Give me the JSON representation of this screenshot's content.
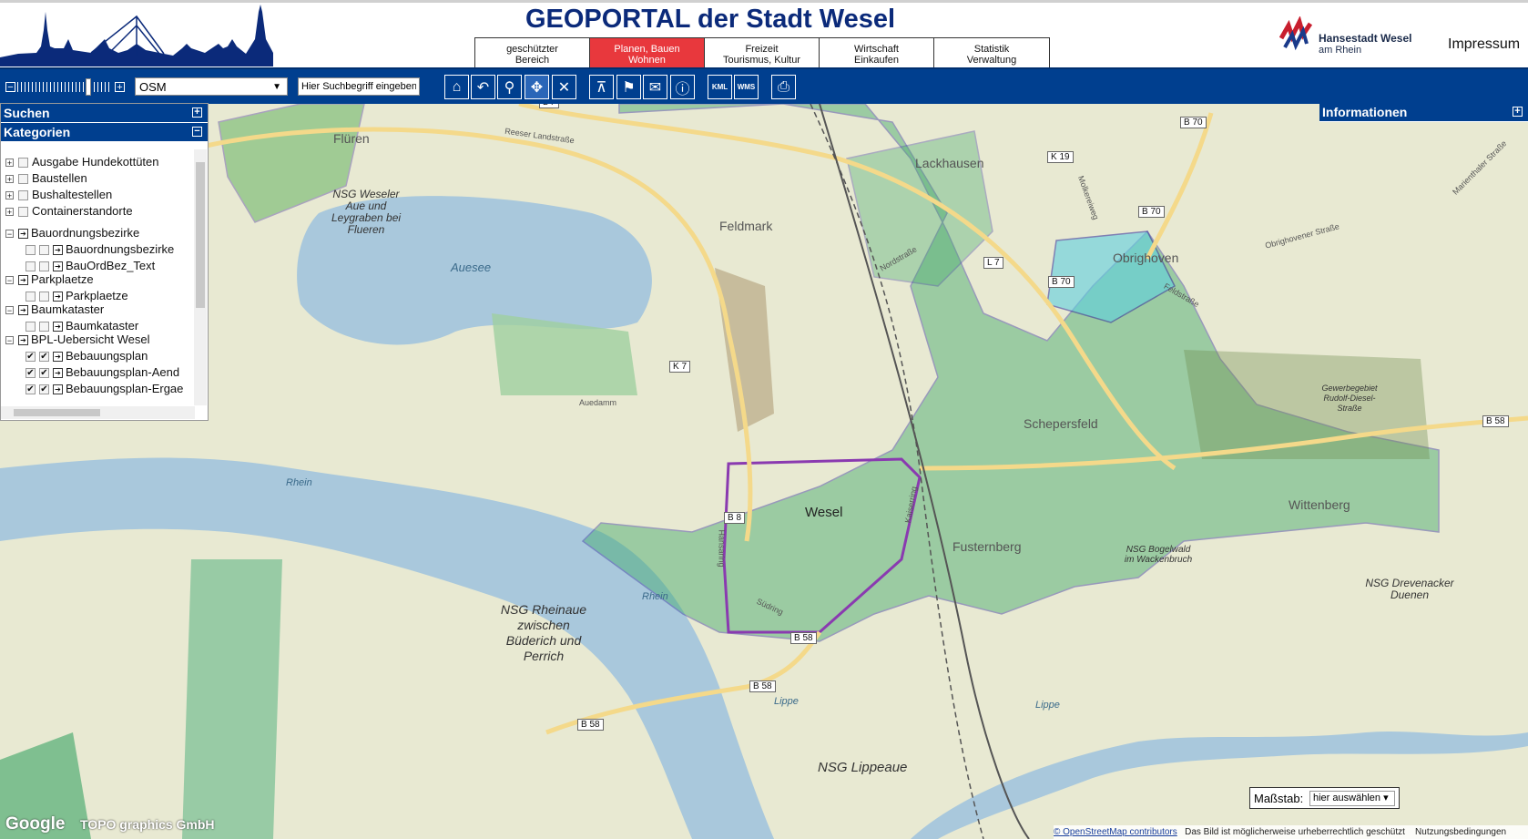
{
  "header": {
    "title": "GEOPORTAL der Stadt Wesel",
    "nav_tabs": [
      {
        "line1": "geschützter",
        "line2": "Bereich"
      },
      {
        "line1": "Planen, Bauen",
        "line2": "Wohnen"
      },
      {
        "line1": "Freizeit",
        "line2": "Tourismus, Kultur"
      },
      {
        "line1": "Wirtschaft",
        "line2": "Einkaufen"
      },
      {
        "line1": "Statistik",
        "line2": "Verwaltung"
      }
    ],
    "logo_name": "Hansestadt Wesel",
    "logo_sub": "am Rhein",
    "impressum": "Impressum"
  },
  "toolbar": {
    "layer_selected": "OSM",
    "search_value": "Hier Suchbegriff eingeben",
    "buttons": [
      "home-icon",
      "back-icon",
      "zoom-icon",
      "pan-icon",
      "clear-icon",
      "measure-icon",
      "flag-icon",
      "mail-icon",
      "info-icon"
    ],
    "kml_label": "KML",
    "wms_label": "WMS"
  },
  "left_panel": {
    "search_title": "Suchen",
    "categories_title": "Kategorien",
    "tree": [
      {
        "label": "Ausgabe Hundekottüten",
        "level": 0,
        "checked": false
      },
      {
        "label": "Baustellen",
        "level": 0,
        "checked": false
      },
      {
        "label": "Bushaltestellen",
        "level": 0,
        "checked": false
      },
      {
        "label": "Containerstandorte",
        "level": 0,
        "checked": false
      },
      {
        "label": "Bauordnungsbezirke",
        "level": 0,
        "checked": false
      },
      {
        "label": "Bauordnungsbezirke",
        "level": 1,
        "checked": false
      },
      {
        "label": "BauOrdBez_Text",
        "level": 1,
        "checked": false
      },
      {
        "label": "Parkplaetze",
        "level": 0,
        "checked": false
      },
      {
        "label": "Parkplaetze",
        "level": 1,
        "checked": false
      },
      {
        "label": "Baumkataster",
        "level": 0,
        "checked": false
      },
      {
        "label": "Baumkataster",
        "level": 1,
        "checked": false
      },
      {
        "label": "BPL-Uebersicht Wesel",
        "level": 0,
        "checked": false
      },
      {
        "label": "Bebauungsplan",
        "level": 1,
        "checked": true
      },
      {
        "label": "Bebauungsplan-Aend",
        "level": 1,
        "checked": true
      },
      {
        "label": "Bebauungsplan-Ergae",
        "level": 1,
        "checked": true
      }
    ]
  },
  "right_panel": {
    "title": "Informationen"
  },
  "map": {
    "places": {
      "flueren": "Flüren",
      "feldmark": "Feldmark",
      "lackhausen": "Lackhausen",
      "obrighoven": "Obrighoven",
      "schepersfeld": "Schepersfeld",
      "wesel": "Wesel",
      "fusternberg": "Fusternberg",
      "wittenberg": "Wittenberg"
    },
    "water": {
      "auesee": "Auesee",
      "rhein": "Rhein",
      "rhein2": "Rhein",
      "lippe": "Lippe",
      "lippe2": "Lippe"
    },
    "nature": {
      "nsg_weseler": "NSG Weseler Aue und Leygraben bei Flueren",
      "nsg_rheinaue": "NSG Rheinaue zwischen Büderich und Perrich",
      "nsg_lippeaue": "NSG Lippeaue",
      "nsg_bogelwald": "NSG Bogelwald im Wackenbruch",
      "nsg_drevenacker": "NSG Drevenacker Duenen",
      "gewerbegebiet": "Gewerbegebiet Rudolf-Diesel-Straße"
    },
    "streets": {
      "reeser": "Reeser Landstraße",
      "auedamm": "Auedamm",
      "nordstrasse": "Nordstraße",
      "feldstrasse": "Feldstraße",
      "obrighovener": "Obrighovener Straße",
      "molkereiweg": "Molkereiweg",
      "marienthaler": "Marienthaler Straße",
      "kaiserring": "Kaiserring",
      "suedring": "Südring",
      "hansaring": "Hansaring"
    },
    "roads": {
      "l7": "L 7",
      "k19": "K 19",
      "b70": "B 70",
      "k7": "K 7",
      "b8": "B 8",
      "b58": "B 58"
    }
  },
  "scale": {
    "label": "Maßstab:",
    "value": "hier auswählen"
  },
  "attribution": {
    "google": "Google",
    "topo": "TOPO graphics GmbH",
    "osm_link": "© OpenStreetMap contributors",
    "note": "Das Bild ist möglicherweise urheberrechtlich geschützt",
    "terms": "Nutzungsbedingungen"
  }
}
